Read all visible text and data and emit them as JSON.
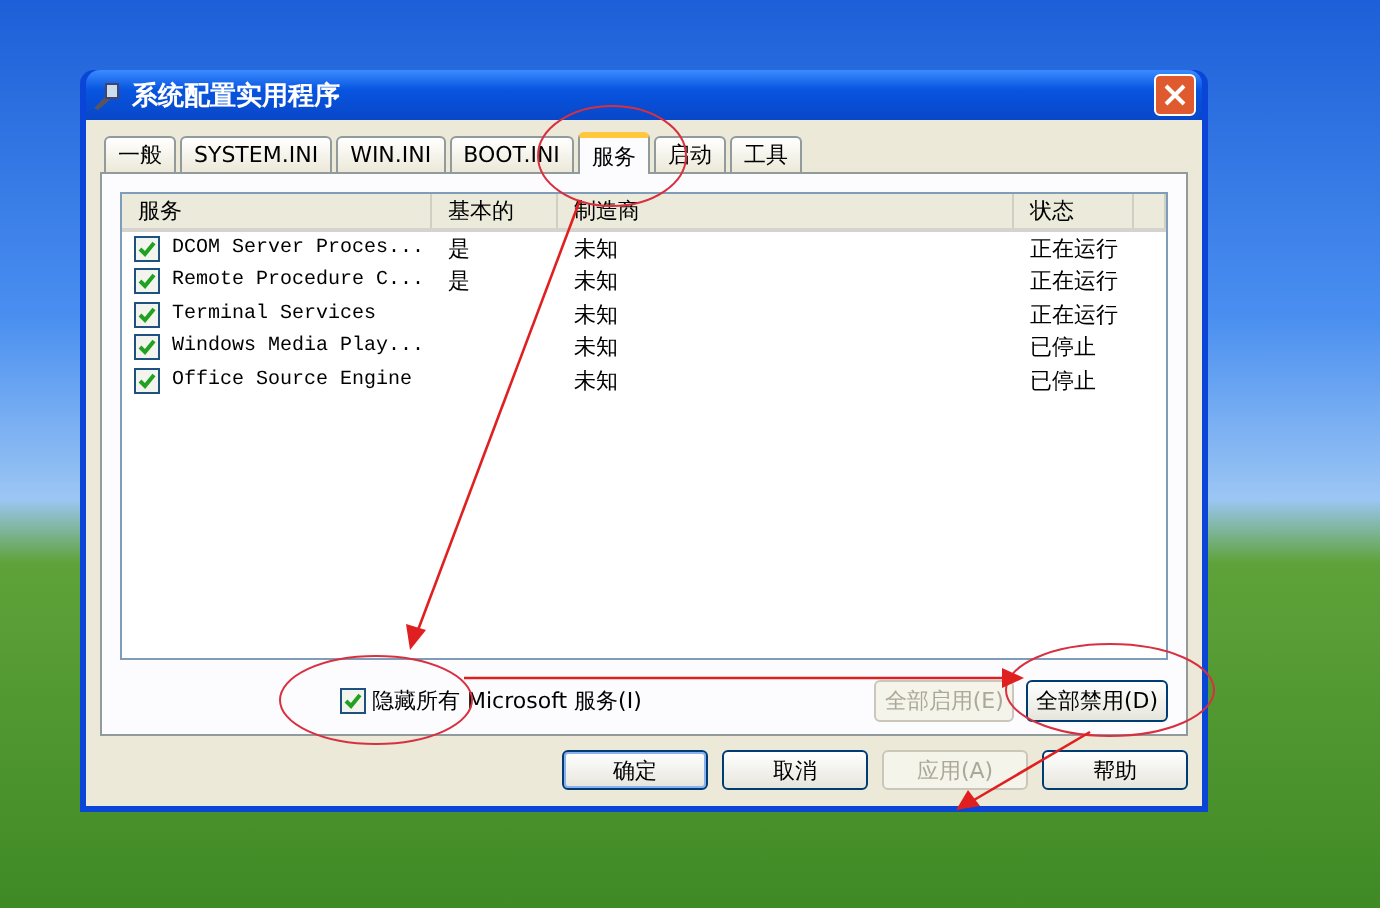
{
  "window": {
    "title": "系统配置实用程序"
  },
  "tabs": [
    {
      "label": "一般",
      "selected": false
    },
    {
      "label": "SYSTEM.INI",
      "selected": false
    },
    {
      "label": "WIN.INI",
      "selected": false
    },
    {
      "label": "BOOT.INI",
      "selected": false
    },
    {
      "label": "服务",
      "selected": true
    },
    {
      "label": "启动",
      "selected": false
    },
    {
      "label": "工具",
      "selected": false
    }
  ],
  "table": {
    "columns": [
      "服务",
      "基本的",
      "制造商",
      "状态"
    ],
    "rows": [
      {
        "checked": true,
        "service": "DCOM Server Proces...",
        "essential": "是",
        "manufacturer": "未知",
        "status": "正在运行"
      },
      {
        "checked": true,
        "service": "Remote Procedure C...",
        "essential": "是",
        "manufacturer": "未知",
        "status": "正在运行"
      },
      {
        "checked": true,
        "service": "Terminal Services",
        "manufacturer": "未知",
        "status": "正在运行"
      },
      {
        "checked": true,
        "service": "Windows Media Play...",
        "manufacturer": "未知",
        "status": "已停止"
      },
      {
        "checked": true,
        "service": "Office Source Engine",
        "manufacturer": "未知",
        "status": "已停止"
      }
    ]
  },
  "hide_microsoft": {
    "label": "隐藏所有 Microsoft 服务(I)",
    "checked": true
  },
  "panel_buttons": [
    {
      "label": "全部启用(E)",
      "disabled": true
    },
    {
      "label": "全部禁用(D)",
      "disabled": false
    }
  ],
  "buttons": [
    {
      "label": "确定",
      "disabled": false,
      "default": true
    },
    {
      "label": "取消",
      "disabled": false,
      "default": false
    },
    {
      "label": "应用(A)",
      "disabled": true,
      "default": false
    },
    {
      "label": "帮助",
      "disabled": false,
      "default": false
    }
  ]
}
